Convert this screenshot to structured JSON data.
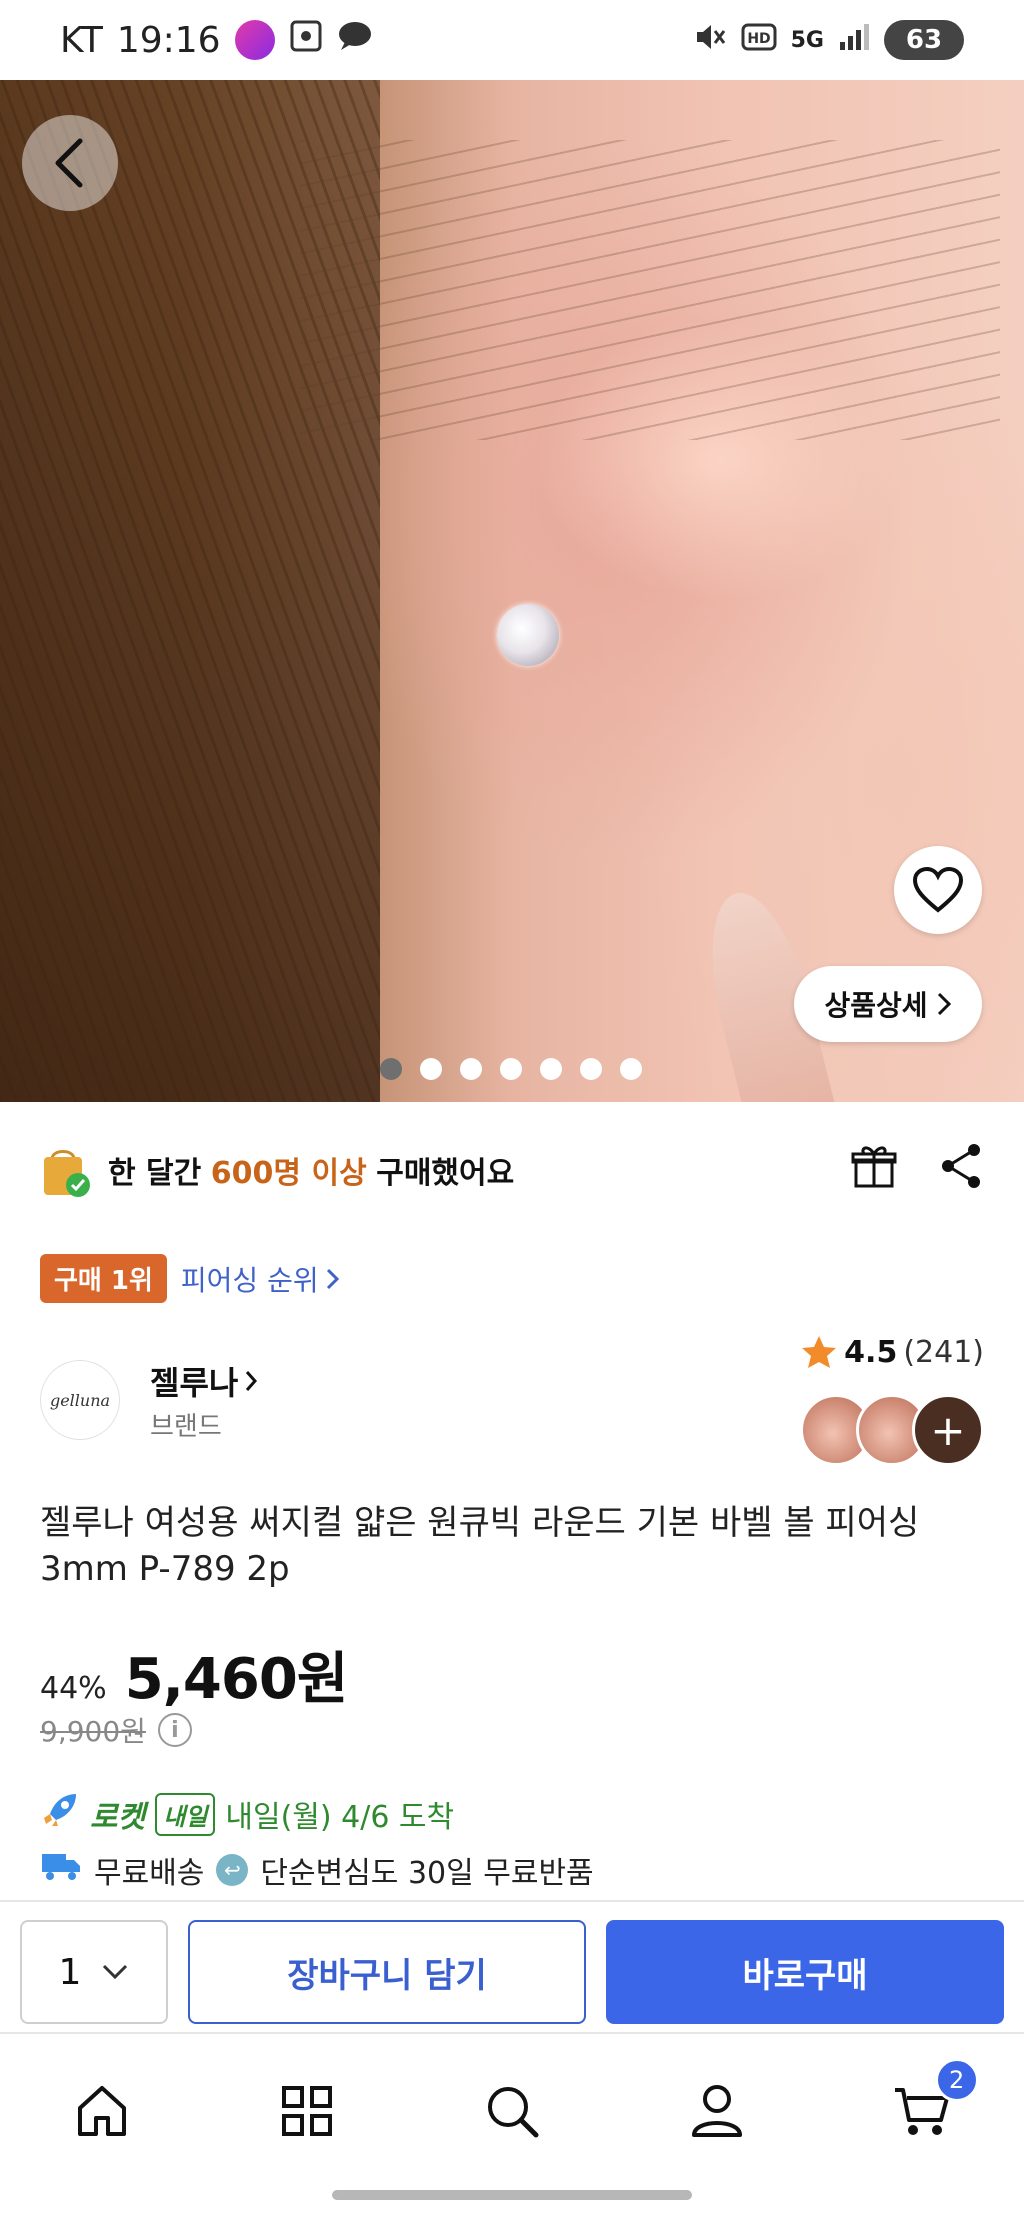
{
  "status_bar": {
    "carrier": "KT",
    "time": "19:16",
    "network": "5G",
    "battery": "63"
  },
  "hero": {
    "detail_button": "상품상세",
    "carousel_count": 7,
    "carousel_active": 0
  },
  "purchase_info": {
    "prefix": "한 달간",
    "highlight": "600명 이상",
    "suffix": "구매했어요"
  },
  "rank": {
    "badge": "구매 1위",
    "link": "피어싱 순위"
  },
  "brand": {
    "logo_text": "gelluna",
    "name": "젤루나",
    "type": "브랜드"
  },
  "rating": {
    "score": "4.5",
    "count": "(241)"
  },
  "product": {
    "title": "젤루나 여성용 써지컬 얇은 원큐빅 라운드 기본 바벨 볼 피어싱 3mm P-789 2p",
    "discount": "44%",
    "price": "5,460원",
    "original_price": "9,900원"
  },
  "delivery": {
    "rocket": "로켓",
    "tomorrow_badge": "내일",
    "arrival": "내일(월) 4/6 도착"
  },
  "shipping": {
    "free_shipping": "무료배송",
    "free_return": "단순변심도 30일 무료반품"
  },
  "buy_bar": {
    "quantity": "1",
    "cart_label": "장바구니 담기",
    "buy_label": "바로구매"
  },
  "bottom_nav": {
    "cart_count": "2"
  },
  "colors": {
    "accent_blue": "#3b66e8",
    "rank_orange": "#d9662a",
    "rocket_green": "#2f8a2f",
    "highlight_orange": "#c8641a"
  }
}
